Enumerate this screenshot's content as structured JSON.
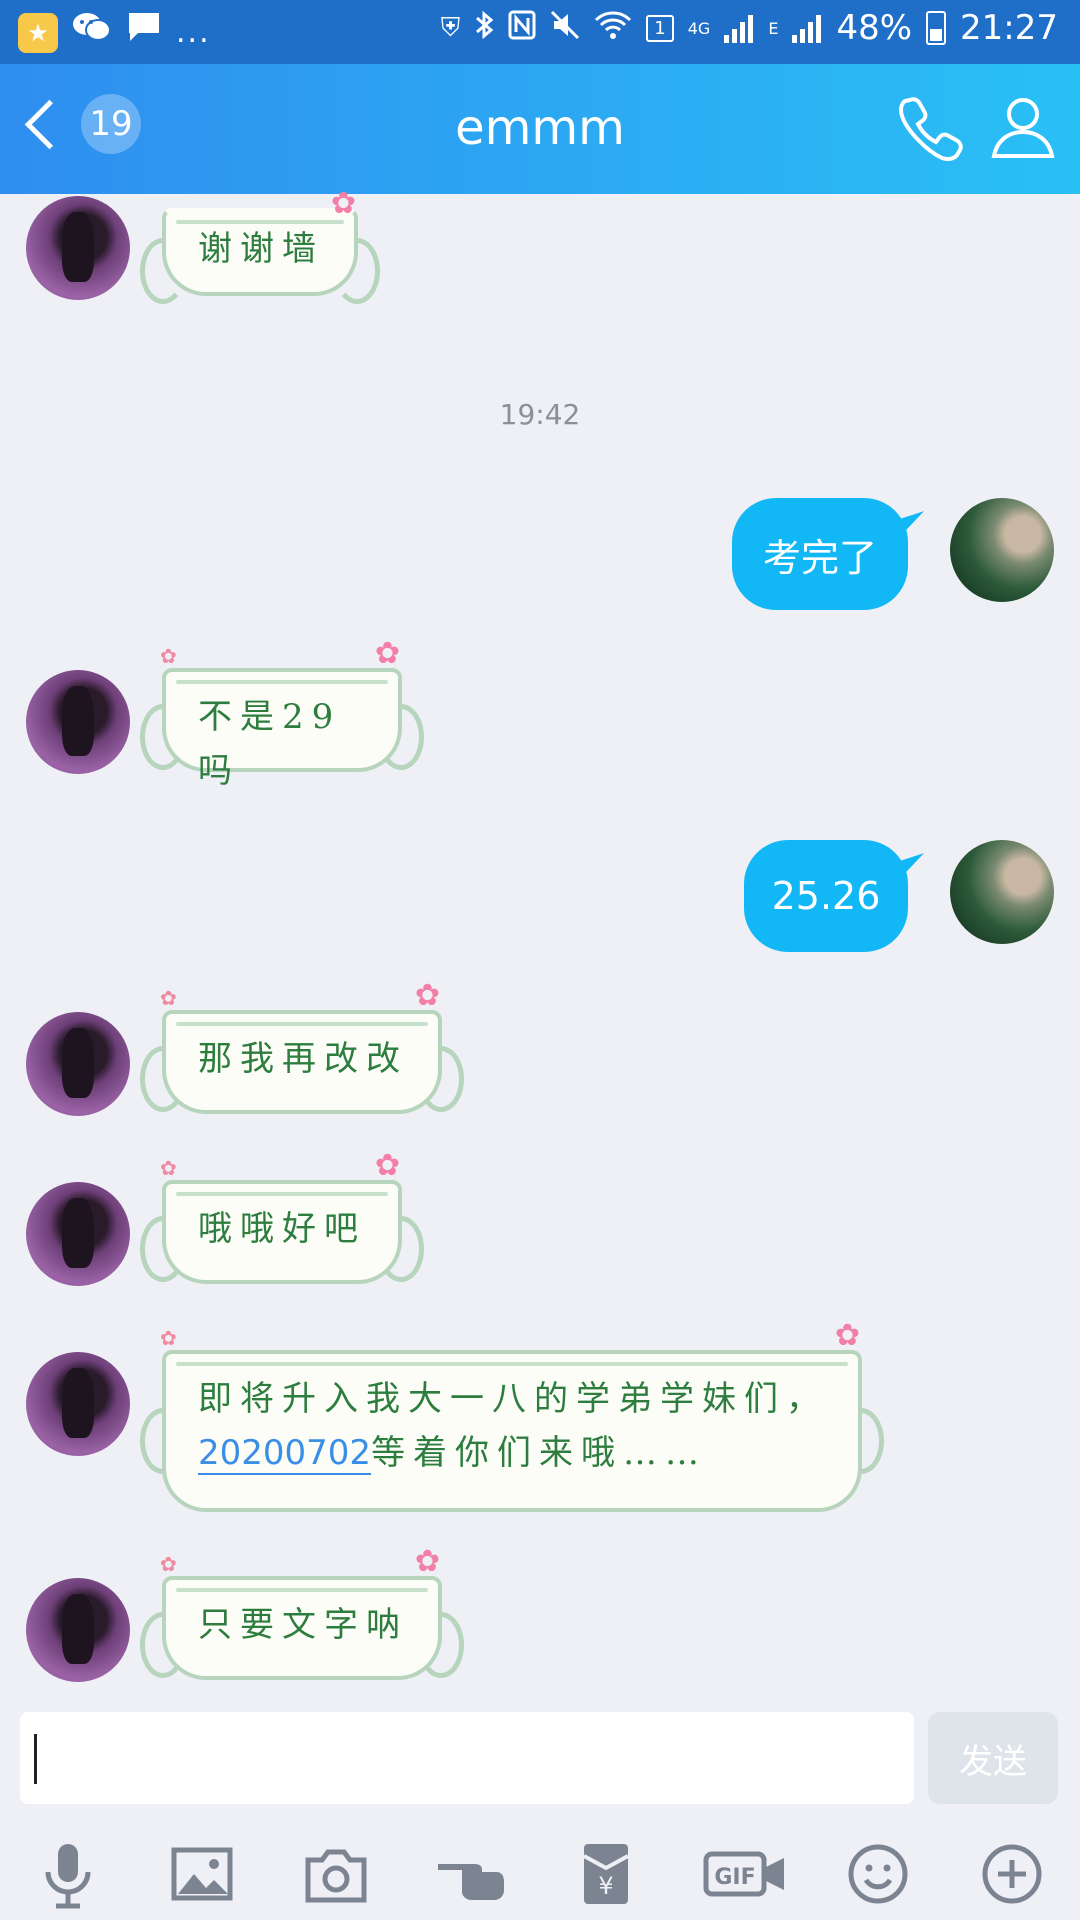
{
  "status_bar": {
    "time": "21:27",
    "battery": "48%",
    "sim_slot": "1",
    "network_4g": "4G",
    "network_e": "E",
    "overflow": "..."
  },
  "header": {
    "title": "emmm",
    "unread_count": "19",
    "icons": [
      "back-icon",
      "phone-icon",
      "profile-icon"
    ]
  },
  "chat": {
    "timestamp": "19:42",
    "messages": [
      {
        "from": "other",
        "text": "谢谢墙"
      },
      {
        "from": "me",
        "text": "考完了"
      },
      {
        "from": "other",
        "text": "不是29吗"
      },
      {
        "from": "me",
        "text": "25.26"
      },
      {
        "from": "other",
        "text": "那我再改改"
      },
      {
        "from": "other",
        "text": "哦哦好吧"
      },
      {
        "from": "other",
        "text_line1": "即将升入我大一八的学弟学妹们，",
        "link": "20200702",
        "text_line2_rest": "等着你们来哦……"
      },
      {
        "from": "other",
        "text": "只要文字呐"
      }
    ]
  },
  "input": {
    "value": "",
    "send_label": "发送"
  },
  "toolbar": {
    "items": [
      "mic-icon",
      "image-icon",
      "camera-icon",
      "poke-icon",
      "red-packet-icon",
      "gif-icon",
      "emoji-icon",
      "plus-icon"
    ],
    "gif_label": "GIF",
    "red_packet_label": "¥"
  },
  "colors": {
    "header_start": "#2f8ef0",
    "header_end": "#29c0f5",
    "my_bubble": "#12b7f5",
    "cute_text": "#2d7d3f",
    "link": "#3a8ee6"
  }
}
